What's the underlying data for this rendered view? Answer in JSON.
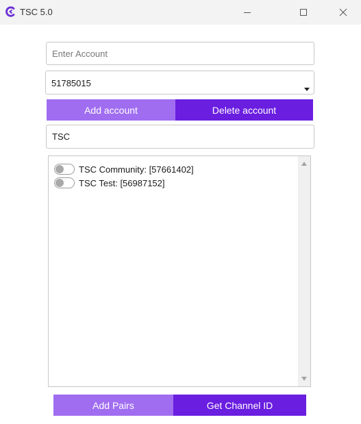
{
  "window": {
    "title": "TSC 5.0"
  },
  "account_input": {
    "placeholder": "Enter Account",
    "value": ""
  },
  "account_select": {
    "selected": "51785015"
  },
  "buttons": {
    "add_account": "Add account",
    "delete_account": "Delete account",
    "add_pairs": "Add Pairs",
    "get_channel_id": "Get Channel ID"
  },
  "filter_input": {
    "value": "TSC"
  },
  "channels": [
    {
      "label": "TSC Community: [57661402]",
      "enabled": false
    },
    {
      "label": "TSC Test: [56987152]",
      "enabled": false
    }
  ],
  "colors": {
    "button_light": "#a06df0",
    "button_dark": "#6a1ee0",
    "app_icon": "#6b2fd6"
  },
  "icons": {
    "app": "app-logo-icon",
    "minimize": "minimize-icon",
    "maximize": "maximize-icon",
    "close": "close-icon"
  }
}
